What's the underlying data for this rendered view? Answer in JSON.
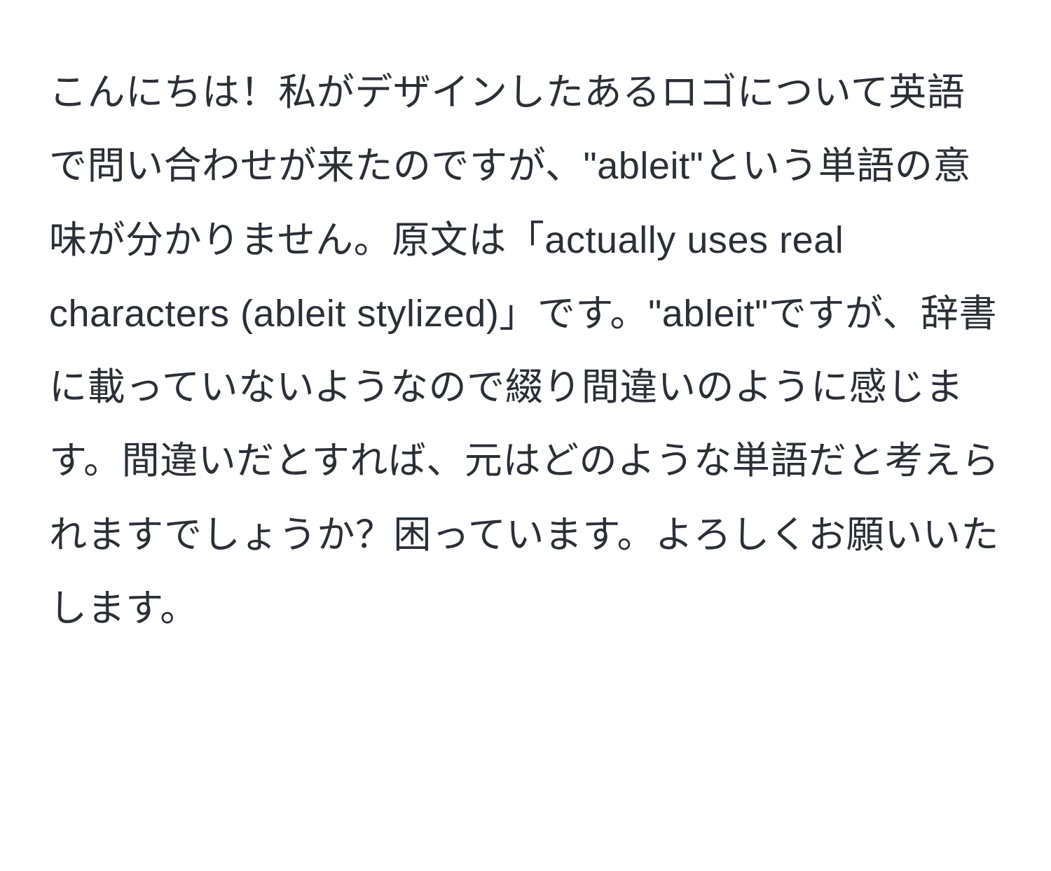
{
  "content": {
    "paragraph": "こんにちは！私がデザインしたあるロゴについて英語で問い合わせが来たのですが、\"ableit\"という単語の意味が分かりません。原文は「actually uses real characters (ableit stylized)」です。\"ableit\"ですが、辞書に載っていないようなので綴り間違いのように感じます。間違いだとすれば、元はどのような単語だと考えられますでしょうか？困っています。よろしくお願いいたします。"
  }
}
